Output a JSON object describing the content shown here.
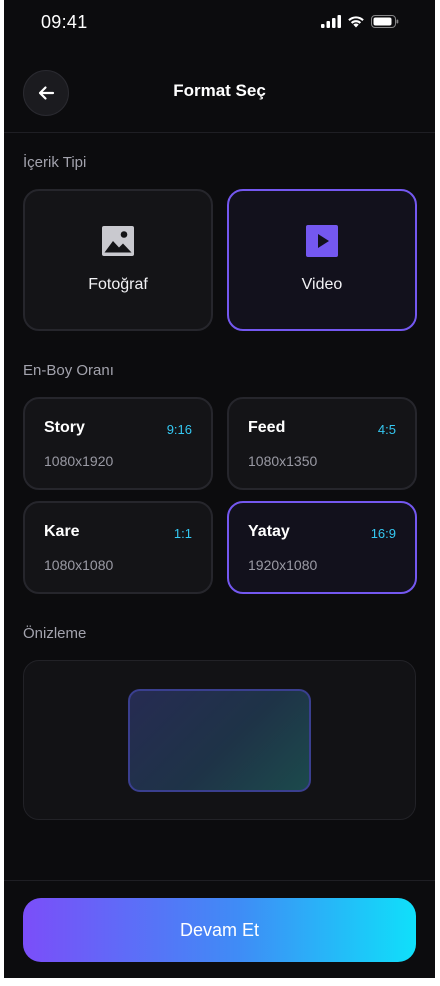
{
  "status_bar": {
    "time": "09:41"
  },
  "header": {
    "title": "Format Seç"
  },
  "content_type": {
    "label": "İçerik Tipi",
    "options": [
      {
        "label": "Fotoğraf",
        "icon": "image-icon",
        "selected": false
      },
      {
        "label": "Video",
        "icon": "play-icon",
        "selected": true
      }
    ]
  },
  "aspect_ratio": {
    "label": "En-Boy Oranı",
    "options": [
      {
        "name": "Story",
        "ratio": "9:16",
        "resolution": "1080x1920",
        "selected": false
      },
      {
        "name": "Feed",
        "ratio": "4:5",
        "resolution": "1080x1350",
        "selected": false
      },
      {
        "name": "Kare",
        "ratio": "1:1",
        "resolution": "1080x1080",
        "selected": false
      },
      {
        "name": "Yatay",
        "ratio": "16:9",
        "resolution": "1920x1080",
        "selected": true
      }
    ]
  },
  "preview": {
    "label": "Önizleme"
  },
  "footer": {
    "continue_label": "Devam Et"
  },
  "colors": {
    "accent": "#7458f0",
    "ratio_text": "#35c8f2",
    "background": "#0c0c0e",
    "cta_gradient_start": "#7b4ef9",
    "cta_gradient_end": "#0fe0fa"
  }
}
